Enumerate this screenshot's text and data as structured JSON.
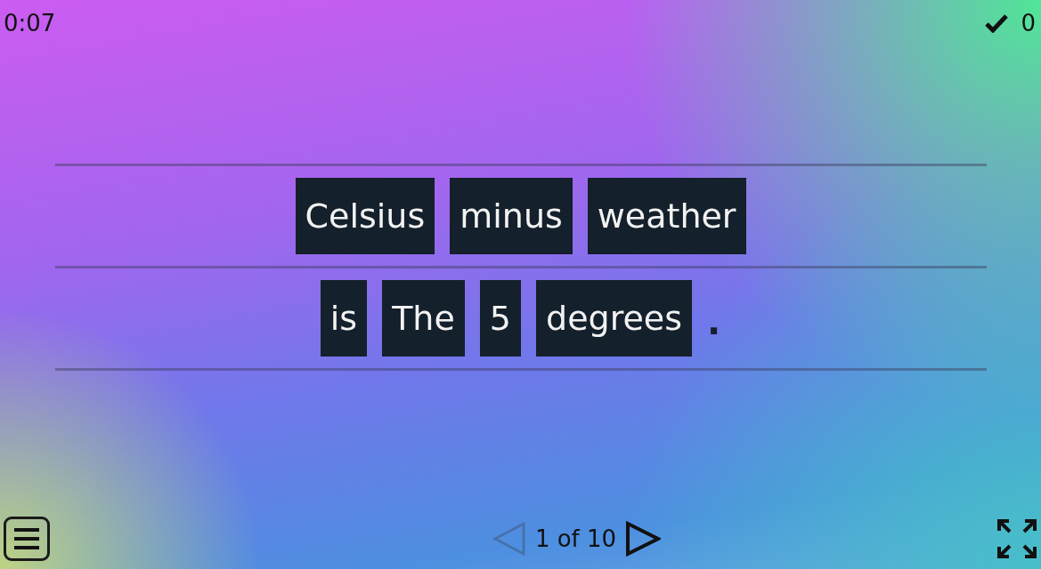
{
  "timer": "0:07",
  "score": "0",
  "rows": [
    {
      "items": [
        {
          "kind": "tile",
          "text": "Celsius"
        },
        {
          "kind": "tile",
          "text": "minus"
        },
        {
          "kind": "tile",
          "text": "weather"
        }
      ]
    },
    {
      "items": [
        {
          "kind": "tile",
          "text": "is"
        },
        {
          "kind": "tile",
          "text": "The"
        },
        {
          "kind": "tile",
          "text": "5"
        },
        {
          "kind": "tile",
          "text": "degrees"
        },
        {
          "kind": "punct",
          "text": "."
        }
      ]
    }
  ],
  "pager": {
    "label": "1 of 10",
    "prev_disabled": true,
    "next_disabled": false
  }
}
